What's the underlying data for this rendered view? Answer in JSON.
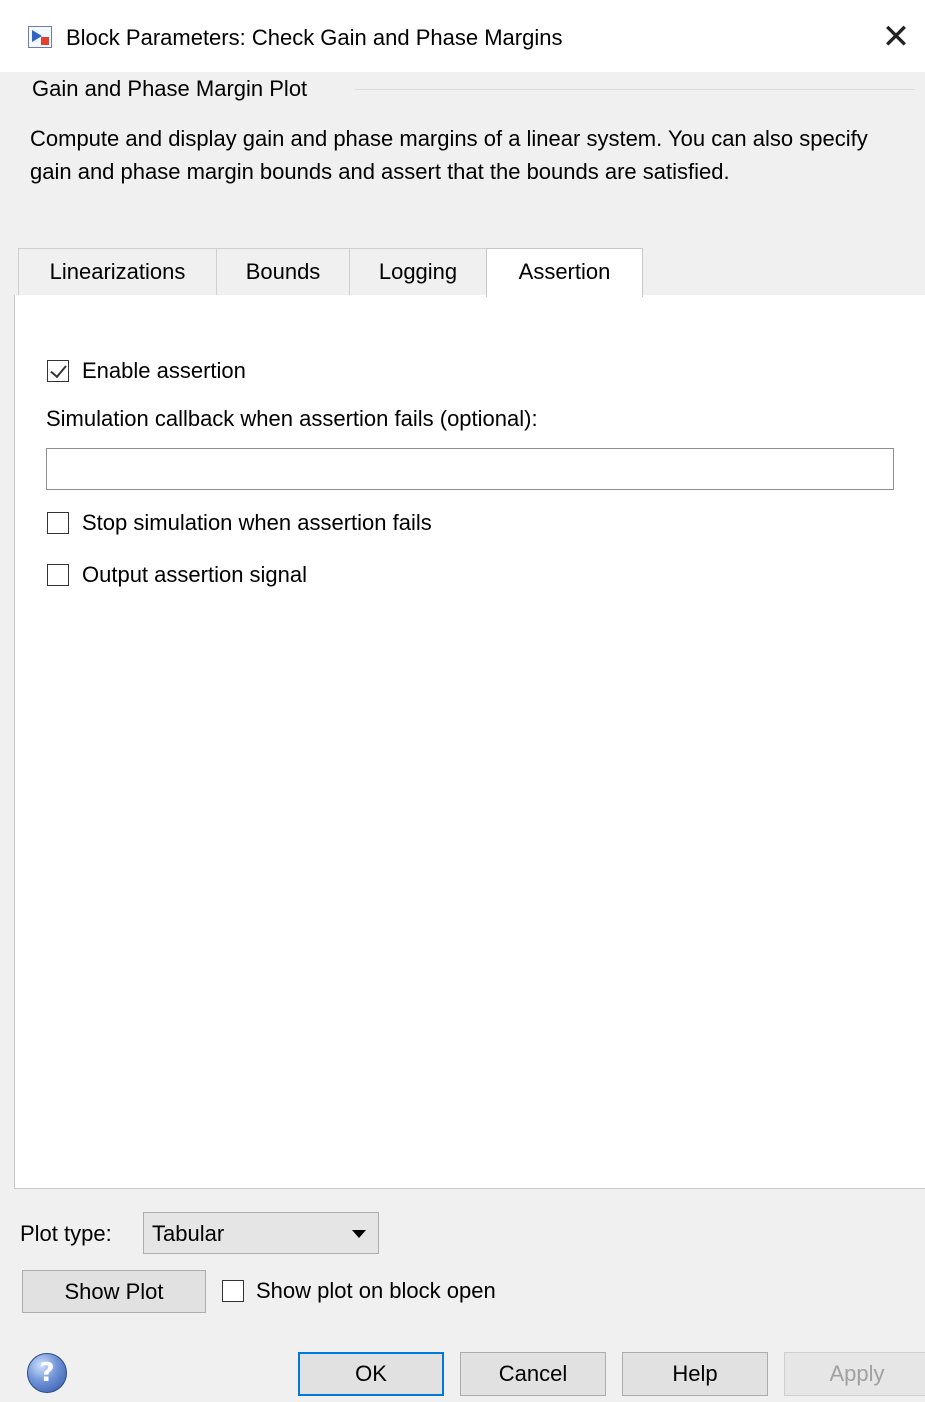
{
  "window": {
    "title": "Block Parameters: Check Gain and Phase Margins",
    "icon": "simulink-block-icon",
    "close_glyph": "✕"
  },
  "group": {
    "title": "Gain and Phase Margin Plot",
    "description": "Compute and display gain and phase margins of a linear system. You can also specify gain and phase margin bounds and assert that the bounds are satisfied."
  },
  "tabs": [
    {
      "label": "Linearizations",
      "active": false
    },
    {
      "label": "Bounds",
      "active": false
    },
    {
      "label": "Logging",
      "active": false
    },
    {
      "label": "Assertion",
      "active": true
    }
  ],
  "assertion": {
    "enable_label": "Enable assertion",
    "enable_checked": true,
    "callback_label": "Simulation callback when assertion fails (optional):",
    "callback_value": "",
    "stop_label": "Stop simulation when assertion fails",
    "stop_checked": false,
    "output_label": "Output assertion signal",
    "output_checked": false
  },
  "plot": {
    "type_label": "Plot type:",
    "type_value": "Tabular",
    "show_button": "Show Plot",
    "show_on_open_label": "Show plot on block open",
    "show_on_open_checked": false
  },
  "buttons": {
    "help_glyph": "?",
    "ok": "OK",
    "cancel": "Cancel",
    "help": "Help",
    "apply": "Apply"
  }
}
